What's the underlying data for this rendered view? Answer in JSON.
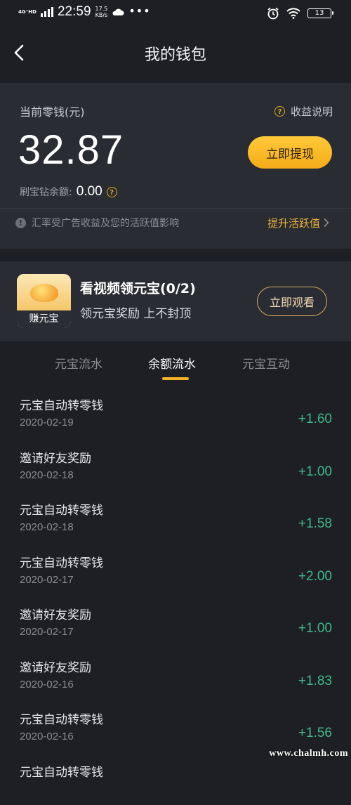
{
  "status_bar": {
    "network": "4G⁺HD",
    "time": "22:59",
    "speed_value": "17.5",
    "speed_unit": "KB/s",
    "battery": "13"
  },
  "nav": {
    "title": "我的钱包"
  },
  "wallet": {
    "label": "当前零钱(元)",
    "earnings_info": "收益说明",
    "balance": "32.87",
    "withdraw_label": "立即提现",
    "diamond_label": "刷宝钻余额:",
    "diamond_value": "0.00",
    "rate_note": "汇率受广告收益及您的活跃值影响",
    "boost_link": "提升活跃值"
  },
  "promo": {
    "image_label": "赚元宝",
    "title": "看视频领元宝(0/2)",
    "subtitle": "领元宝奖励 上不封顶",
    "watch_label": "立即观看"
  },
  "tabs": [
    {
      "label": "元宝流水",
      "active": false
    },
    {
      "label": "余额流水",
      "active": true
    },
    {
      "label": "元宝互动",
      "active": false
    }
  ],
  "transactions": [
    {
      "title": "元宝自动转零钱",
      "date": "2020-02-19",
      "amount": "+1.60"
    },
    {
      "title": "邀请好友奖励",
      "date": "2020-02-18",
      "amount": "+1.00"
    },
    {
      "title": "元宝自动转零钱",
      "date": "2020-02-18",
      "amount": "+1.58"
    },
    {
      "title": "元宝自动转零钱",
      "date": "2020-02-17",
      "amount": "+2.00"
    },
    {
      "title": "邀请好友奖励",
      "date": "2020-02-17",
      "amount": "+1.00"
    },
    {
      "title": "邀请好友奖励",
      "date": "2020-02-16",
      "amount": "+1.83"
    },
    {
      "title": "元宝自动转零钱",
      "date": "2020-02-16",
      "amount": "+1.56"
    },
    {
      "title": "元宝自动转零钱",
      "date": "",
      "amount": ""
    }
  ],
  "watermark": "www.chalmh.com",
  "colors": {
    "background": "#1e1f25",
    "card": "#2a2c33",
    "accent_gold": "#f5b324",
    "amount_green": "#41b88a"
  }
}
